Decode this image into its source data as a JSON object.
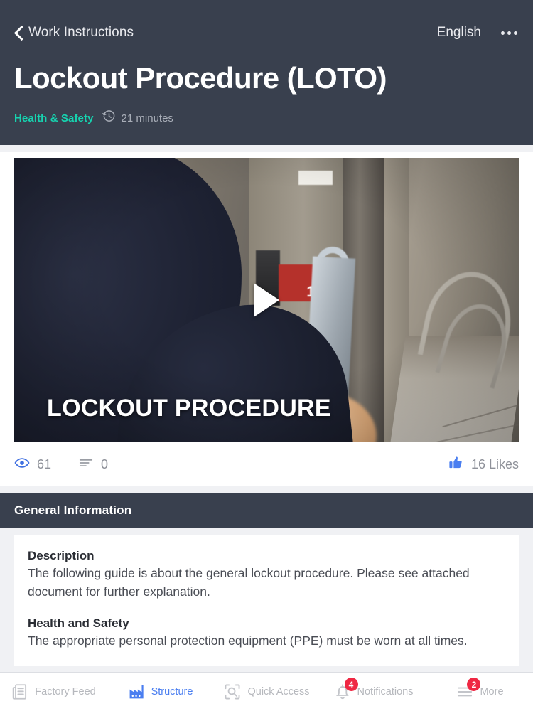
{
  "header": {
    "back_label": "Work Instructions",
    "back_icon": "chevron-left-icon",
    "language": "English",
    "overflow_icon": "more-horizontal-icon",
    "title": "Lockout Procedure (LOTO)",
    "category": "Health & Safety",
    "category_color": "#16d4b0",
    "duration_icon": "clock-history-icon",
    "duration": "21 minutes",
    "background_color": "#39404e"
  },
  "media": {
    "type": "video",
    "play_icon": "play-triangle-icon",
    "caption": "LOCKOUT PROCEDURE"
  },
  "stats": {
    "views_icon": "eye-icon",
    "views": "61",
    "comments_icon": "lines-icon",
    "comments": "0",
    "likes_icon": "thumbs-up-icon",
    "likes": "16 Likes",
    "accent_color": "#4a7ef0"
  },
  "section": {
    "title": "General Information"
  },
  "content": {
    "blocks": [
      {
        "title": "Description",
        "body": "The following guide is about the general lockout procedure. Please see attached document for further explanation."
      },
      {
        "title": "Health and Safety",
        "body": "The appropriate personal protection equipment (PPE) must be worn at all times."
      }
    ]
  },
  "bottom_nav": {
    "items": [
      {
        "label": "Factory Feed",
        "icon": "document-feed-icon",
        "active": false,
        "badge": null
      },
      {
        "label": "Structure",
        "icon": "factory-icon",
        "active": true,
        "badge": null
      },
      {
        "label": "Quick Access",
        "icon": "scan-search-icon",
        "active": false,
        "badge": null
      },
      {
        "label": "Notifications",
        "icon": "bell-icon",
        "active": false,
        "badge": "4"
      },
      {
        "label": "More",
        "icon": "hamburger-icon",
        "active": false,
        "badge": "2"
      }
    ],
    "badge_color": "#ef2743",
    "active_color": "#4a7ef0"
  }
}
